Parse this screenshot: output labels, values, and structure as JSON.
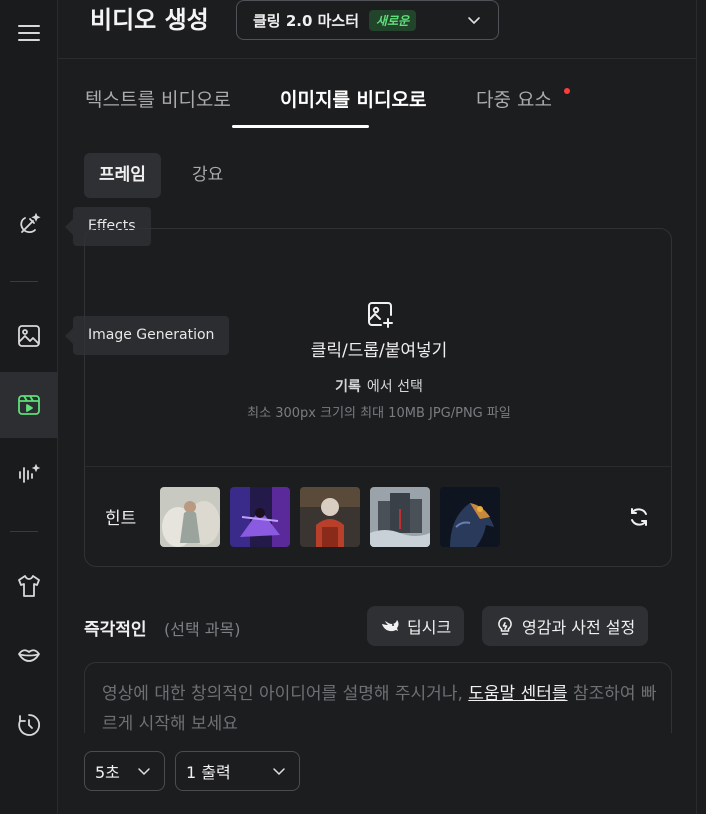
{
  "sidebar": {
    "items": [
      {
        "name": "menu",
        "icon": "hamburger-menu-icon"
      },
      {
        "name": "effects",
        "icon": "effects-icon"
      },
      {
        "name": "image-generation",
        "icon": "image-icon"
      },
      {
        "name": "video-generation",
        "icon": "video-icon",
        "active": true
      },
      {
        "name": "audio",
        "icon": "audio-wave-icon"
      },
      {
        "name": "virtual-try-on",
        "icon": "shirt-icon"
      },
      {
        "name": "lip-sync",
        "icon": "lips-icon"
      },
      {
        "name": "history",
        "icon": "history-icon"
      }
    ],
    "tooltips": {
      "effects": "Effects",
      "image_generation": "Image Generation"
    },
    "active_color": "#5fde7a"
  },
  "header": {
    "title": "비디오 생성",
    "model": {
      "name": "클링 2.0 마스터",
      "badge": "새로운"
    }
  },
  "tabs": {
    "items": [
      {
        "label": "텍스트를 비디오로"
      },
      {
        "label": "이미지를 비디오로",
        "active": true
      },
      {
        "label": "다중 요소",
        "has_dot": true
      }
    ]
  },
  "subtabs": {
    "frame": "프레임",
    "outline": "강요"
  },
  "upload": {
    "label": "클릭/드롭/붙여넣기",
    "history_link": "기록",
    "history_suffix": "에서 선택",
    "note": "최소 300px 크기의 최대 10MB JPG/PNG 파일",
    "hint_label": "힌트"
  },
  "prompt": {
    "title": "즉각적인",
    "optional": "(선택 과목)",
    "deepseek_label": "딥시크",
    "inspiration_label": "영감과 사전 설정",
    "placeholder_before": "영상에 대한 창의적인 아이디어를 설명해 주시거나, ",
    "help_link": "도움말 센터를",
    "placeholder_after": " 참조하여 빠르게 시작해 보세요"
  },
  "options": {
    "duration": "5초",
    "outputs": "1 출력"
  }
}
